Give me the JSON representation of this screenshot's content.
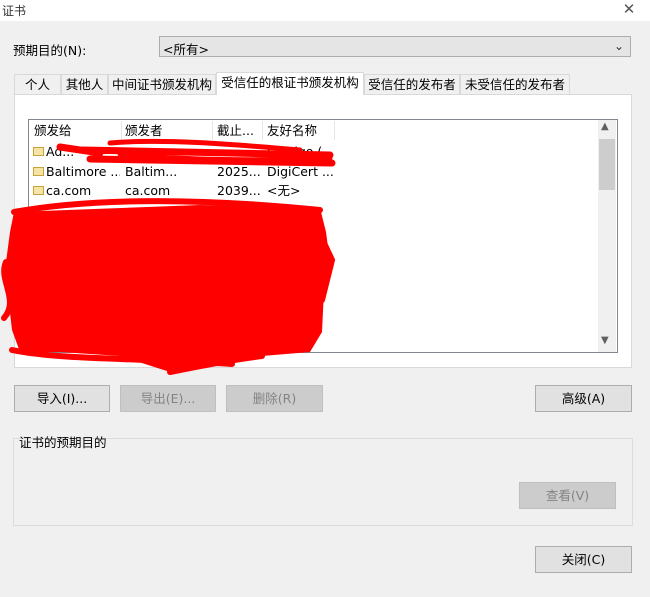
{
  "window": {
    "title": "证书"
  },
  "icons": {
    "close": "close-icon",
    "dropdown": "chevron-down-icon",
    "scroll_up": "chevron-up-icon",
    "scroll_down": "chevron-down-icon",
    "certificate": "certificate-icon"
  },
  "purpose": {
    "label": "预期目的(N):",
    "selected": "<所有>"
  },
  "tabs": [
    {
      "label": "个人"
    },
    {
      "label": "其他人"
    },
    {
      "label": "中间证书颁发机构"
    },
    {
      "label": "受信任的根证书颁发机构",
      "active": true
    },
    {
      "label": "受信任的发布者"
    },
    {
      "label": "未受信任的发布者"
    }
  ],
  "list": {
    "columns": [
      "颁发给",
      "颁发者",
      "截止...",
      "友好名称"
    ],
    "rows": [
      {
        "issued_to": "Ad...",
        "issuer": "",
        "expires": "",
        "friendly": "Sectigo (..."
      },
      {
        "issued_to": "Baltimore ...",
        "issuer": "Baltim...",
        "expires": "2025...",
        "friendly": "DigiCert ..."
      },
      {
        "issued_to": "ca.com",
        "issuer": "ca.com",
        "expires": "2039...",
        "friendly": "<无>"
      }
    ]
  },
  "buttons": {
    "import": "导入(I)...",
    "export": "导出(E)...",
    "remove": "删除(R)",
    "advanced": "高级(A)",
    "view": "查看(V)",
    "close": "关闭(C)"
  },
  "purposes_group": {
    "label": "证书的预期目的"
  },
  "colors": {
    "redaction": "#ff0000",
    "window_bg": "#f0f0f0"
  }
}
